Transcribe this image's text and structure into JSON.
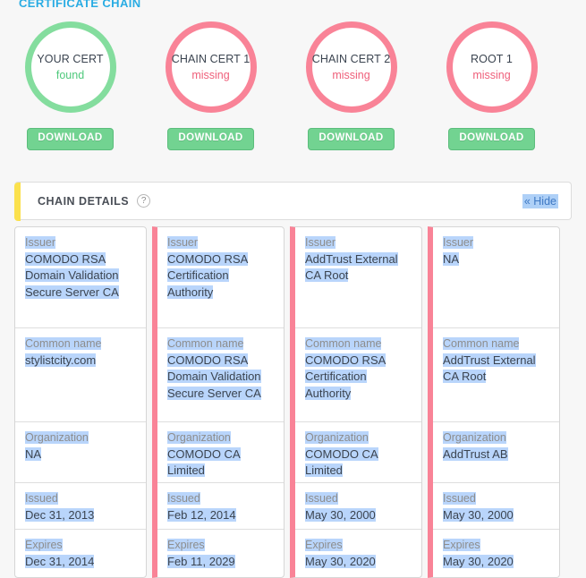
{
  "section": {
    "title": "CERTIFICATE CHAIN"
  },
  "colors": {
    "heading": "#29ace3",
    "found_ring": "#84dd9e",
    "missing_ring": "#f98397",
    "found_text": "#4fc97c",
    "missing_text": "#ef5f7a",
    "download_button": "#72d391",
    "accent_bar": "#fbe14d",
    "selection_highlight": "#b9d5fb",
    "page_background": "#f7f7f7"
  },
  "certs": [
    {
      "name": "YOUR CERT",
      "status": "found",
      "state": "found",
      "download_label": "DOWNLOAD"
    },
    {
      "name": "CHAIN CERT 1",
      "status": "missing",
      "state": "missing",
      "download_label": "DOWNLOAD"
    },
    {
      "name": "CHAIN CERT 2",
      "status": "missing",
      "state": "missing",
      "download_label": "DOWNLOAD"
    },
    {
      "name": "ROOT 1",
      "status": "missing",
      "state": "missing",
      "download_label": "DOWNLOAD"
    }
  ],
  "details": {
    "title": "CHAIN DETAILS",
    "help_icon": "question-mark-icon",
    "hide_label": "« Hide",
    "labels": {
      "issuer": "Issuer",
      "common_name": "Common name",
      "organization": "Organization",
      "issued": "Issued",
      "expires": "Expires"
    },
    "columns": [
      {
        "flagged": false,
        "issuer": "COMODO RSA Domain Validation Secure Server CA",
        "common_name": "stylistcity.com",
        "organization": "NA",
        "issued": "Dec 31, 2013",
        "expires": "Dec 31, 2014"
      },
      {
        "flagged": true,
        "issuer": "COMODO RSA Certification Authority",
        "common_name": "COMODO RSA Domain Validation Secure Server CA",
        "organization": "COMODO CA Limited",
        "issued": "Feb 12, 2014",
        "expires": "Feb 11, 2029"
      },
      {
        "flagged": true,
        "issuer": "AddTrust External CA Root",
        "common_name": "COMODO RSA Certification Authority",
        "organization": "COMODO CA Limited",
        "issued": "May 30, 2000",
        "expires": "May 30, 2020"
      },
      {
        "flagged": true,
        "issuer": "NA",
        "common_name": "AddTrust External CA Root",
        "organization": "AddTrust AB",
        "issued": "May 30, 2000",
        "expires": "May 30, 2020"
      }
    ]
  }
}
